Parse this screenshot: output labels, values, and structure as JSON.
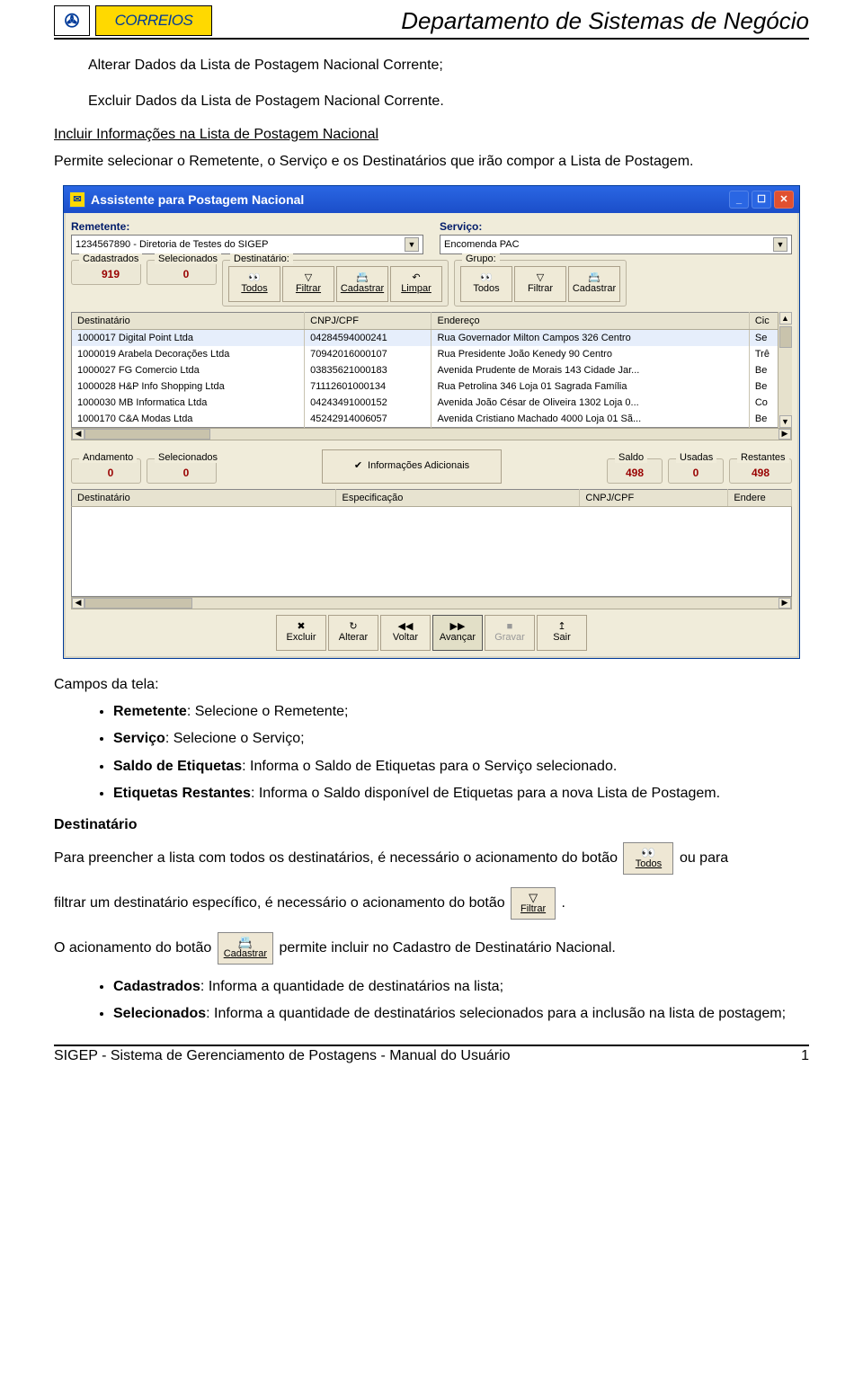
{
  "header": {
    "dept_title": "Departamento de Sistemas de Negócio",
    "brand": "CORREIOS",
    "brand_symbol": "✇"
  },
  "text": {
    "alterar": "Alterar Dados da Lista de Postagem Nacional Corrente;",
    "excluir": "Excluir Dados da Lista de Postagem Nacional Corrente.",
    "incluir_heading": "Incluir Informações na Lista de Postagem Nacional",
    "incluir_desc": "Permite selecionar o Remetente, o Serviço e os Destinatários que irão compor a Lista de Postagem.",
    "campos_heading": "Campos da tela:",
    "li_remetente_b": "Remetente",
    "li_remetente_t": ": Selecione o Remetente;",
    "li_servico_b": "Serviço",
    "li_servico_t": ": Selecione o Serviço;",
    "li_saldo_b": "Saldo de Etiquetas",
    "li_saldo_t": ": Informa o Saldo de Etiquetas para o Serviço selecionado.",
    "li_rest_b": "Etiquetas Restantes",
    "li_rest_t": ": Informa o Saldo disponível de Etiquetas para a nova Lista de Postagem.",
    "dest_heading": "Destinatário",
    "para_todos_a": "Para preencher a lista com todos os destinatários, é necessário o acionamento do botão ",
    "para_todos_b": "ou para",
    "para_filtrar_a": "filtrar um destinatário específico, é necessário o acionamento do botão ",
    "para_filtrar_b": ".",
    "para_cadastrar_a": "O acionamento do botão ",
    "para_cadastrar_b": "permite incluir no Cadastro de Destinatário Nacional.",
    "li_cadastrados_b": "Cadastrados",
    "li_cadastrados_t": ": Informa a quantidade de destinatários na lista;",
    "li_selecionados_b": "Selecionados",
    "li_selecionados_t": ": Informa a quantidade de destinatários selecionados para a inclusão na lista de postagem;"
  },
  "inline_icons": {
    "todos_label": "Todos",
    "todos_icon": "👀",
    "filtrar_label": "Filtrar",
    "filtrar_icon": "▽",
    "cadastrar_label": "Cadastrar",
    "cadastrar_icon": "📇"
  },
  "win": {
    "title": "Assistente para Postagem Nacional",
    "remetente_label": "Remetente:",
    "remetente_value": "1234567890 - Diretoria de Testes do SIGEP",
    "servico_label": "Serviço:",
    "servico_value": "Encomenda PAC",
    "cadastrados_label": "Cadastrados",
    "cadastrados_value": "919",
    "selecionados_label": "Selecionados",
    "selecionados_value": "0",
    "dest_group": "Destinatário:",
    "grupo_group": "Grupo:",
    "tb_todos": "Todos",
    "tb_filtrar": "Filtrar",
    "tb_cadastrar": "Cadastrar",
    "tb_limpar": "Limpar",
    "grid1_headers": [
      "Destinatário",
      "CNPJ/CPF",
      "Endereço",
      "Cic"
    ],
    "grid1_rows": [
      [
        "1000017 Digital Point Ltda",
        "04284594000241",
        "Rua Governador Milton Campos 326  Centro",
        "Se"
      ],
      [
        "1000019 Arabela Decorações Ltda",
        "70942016000107",
        "Rua Presidente João Kenedy 90  Centro",
        "Trê"
      ],
      [
        "1000027 FG Comercio Ltda",
        "03835621000183",
        "Avenida Prudente de Morais 143  Cidade Jar...",
        "Be"
      ],
      [
        "1000028 H&P Info Shopping Ltda",
        "71112601000134",
        "Rua Petrolina 346 Loja 01 Sagrada Família",
        "Be"
      ],
      [
        "1000030 MB Informatica Ltda",
        "04243491000152",
        "Avenida João César de Oliveira 1302 Loja 0...",
        "Co"
      ],
      [
        "1000170 C&A Modas Ltda",
        "45242914006057",
        "Avenida Cristiano Machado 4000 Loja 01 Sã...",
        "Be"
      ]
    ],
    "andamento_label": "Andamento",
    "andamento_value": "0",
    "selecionados2_label": "Selecionados",
    "selecionados2_value": "0",
    "info_adic_label": "Informações Adicionais",
    "saldo_label": "Saldo",
    "saldo_value": "498",
    "usadas_label": "Usadas",
    "usadas_value": "0",
    "restantes_label": "Restantes",
    "restantes_value": "498",
    "grid2_headers": [
      "Destinatário",
      "Especificação",
      "CNPJ/CPF",
      "Endere"
    ],
    "action_excluir": "Excluir",
    "action_alterar": "Alterar",
    "action_voltar": "Voltar",
    "action_avancar": "Avançar",
    "action_gravar": "Gravar",
    "action_sair": "Sair",
    "ic_excluir": "✖",
    "ic_alterar": "↻",
    "ic_voltar": "◀◀",
    "ic_avancar": "▶▶",
    "ic_gravar": "■",
    "ic_sair": "↥",
    "ic_todos": "👀",
    "ic_filtrar": "▽",
    "ic_cadastrar": "📇",
    "ic_limpar": "↶",
    "ic_check": "✔"
  },
  "footer": {
    "left": "SIGEP - Sistema de Gerenciamento de Postagens - Manual do Usuário",
    "right": "1"
  }
}
